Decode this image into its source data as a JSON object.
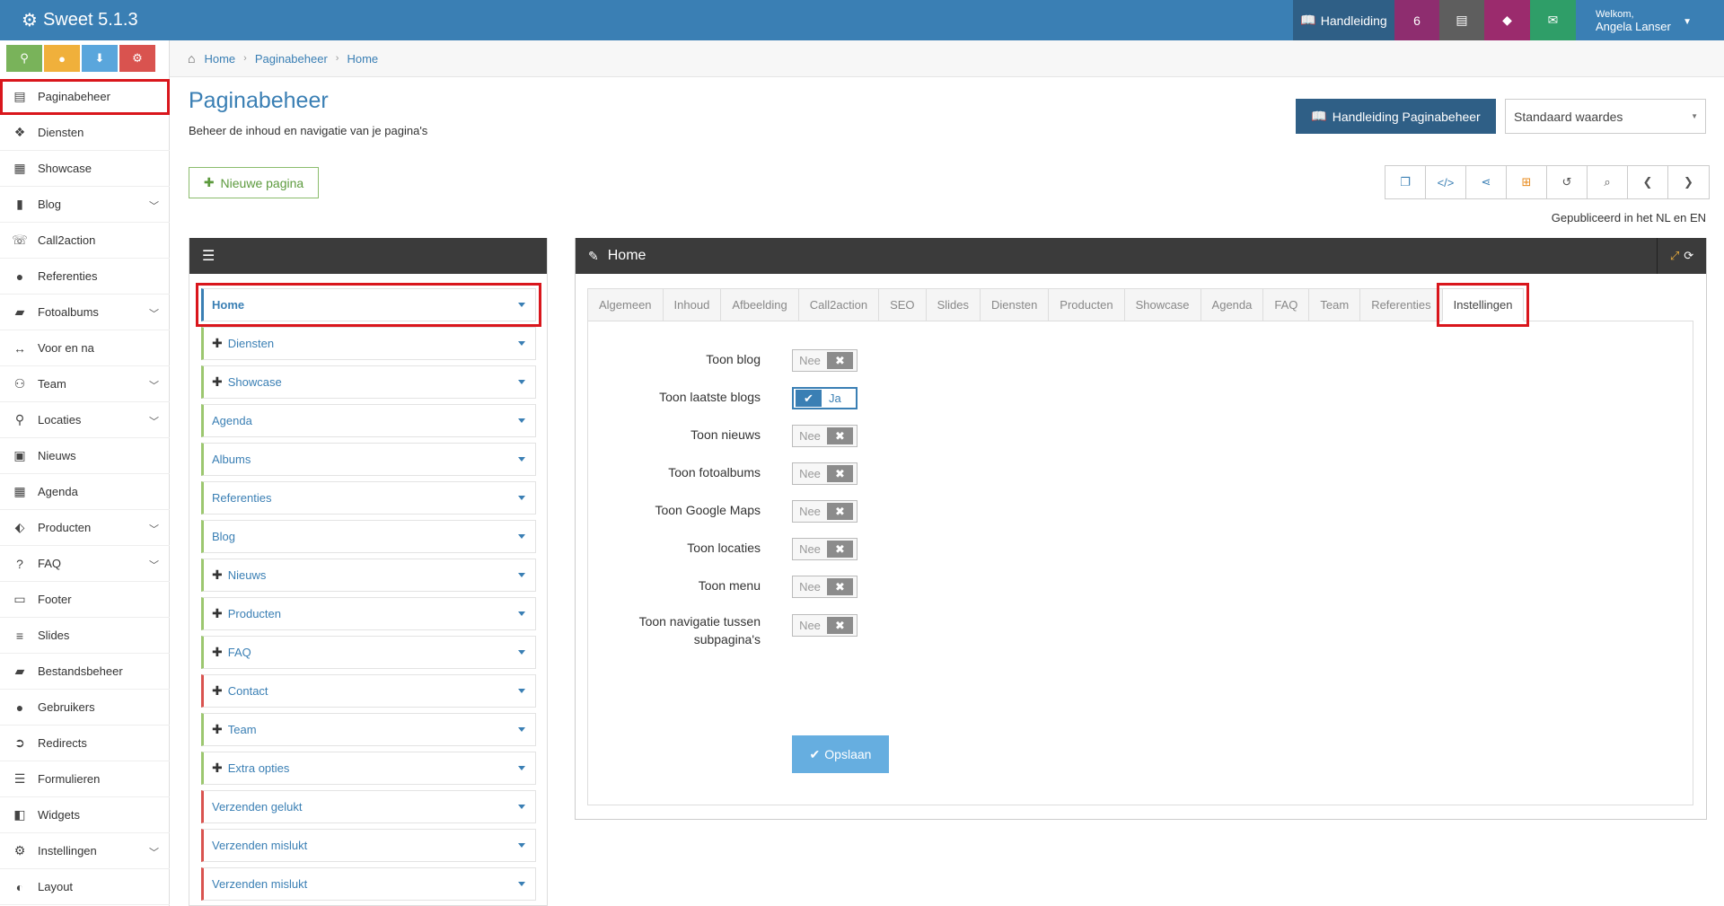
{
  "app": {
    "title": "Sweet 5.1.3"
  },
  "topbar": {
    "manual_label": "Handleiding",
    "count": "6",
    "welcome": "Welkom,",
    "user": "Angela Lanser"
  },
  "sidebar": {
    "items": [
      {
        "label": "Paginabeheer",
        "icon": "table-icon",
        "chevron": false
      },
      {
        "label": "Diensten",
        "icon": "cubes-icon",
        "chevron": false
      },
      {
        "label": "Showcase",
        "icon": "grid-icon",
        "chevron": false
      },
      {
        "label": "Blog",
        "icon": "file-icon",
        "chevron": true
      },
      {
        "label": "Call2action",
        "icon": "phone-icon",
        "chevron": false
      },
      {
        "label": "Referenties",
        "icon": "comments-icon",
        "chevron": false
      },
      {
        "label": "Fotoalbums",
        "icon": "book-icon",
        "chevron": true
      },
      {
        "label": "Voor en na",
        "icon": "arrows-h-icon",
        "chevron": false
      },
      {
        "label": "Team",
        "icon": "users-icon",
        "chevron": true
      },
      {
        "label": "Locaties",
        "icon": "map-marker-icon",
        "chevron": true
      },
      {
        "label": "Nieuws",
        "icon": "newspaper-icon",
        "chevron": false
      },
      {
        "label": "Agenda",
        "icon": "calendar-icon",
        "chevron": false
      },
      {
        "label": "Producten",
        "icon": "tags-icon",
        "chevron": true
      },
      {
        "label": "FAQ",
        "icon": "question-icon",
        "chevron": true
      },
      {
        "label": "Footer",
        "icon": "footer-icon",
        "chevron": false
      },
      {
        "label": "Slides",
        "icon": "sliders-icon",
        "chevron": false
      },
      {
        "label": "Bestandsbeheer",
        "icon": "folder-icon",
        "chevron": false
      },
      {
        "label": "Gebruikers",
        "icon": "user-icon",
        "chevron": false
      },
      {
        "label": "Redirects",
        "icon": "redirect-icon",
        "chevron": false
      },
      {
        "label": "Formulieren",
        "icon": "form-icon",
        "chevron": false
      },
      {
        "label": "Widgets",
        "icon": "widget-icon",
        "chevron": false
      },
      {
        "label": "Instellingen",
        "icon": "gear-icon",
        "chevron": true
      },
      {
        "label": "Layout",
        "icon": "palette-icon",
        "chevron": false
      }
    ]
  },
  "breadcrumb": [
    "Home",
    "Paginabeheer",
    "Home"
  ],
  "page": {
    "title": "Paginabeheer",
    "subtitle": "Beheer de inhoud en navigatie van je pagina's",
    "manual_button": "Handleiding Paginabeheer",
    "select_value": "Standaard waardes",
    "new_page": "Nieuwe pagina",
    "published": "Gepubliceerd in het NL en EN"
  },
  "tree": {
    "items": [
      {
        "label": "Home",
        "plus": false,
        "color": "blue"
      },
      {
        "label": "Diensten",
        "plus": true,
        "color": "green"
      },
      {
        "label": "Showcase",
        "plus": true,
        "color": "green"
      },
      {
        "label": "Agenda",
        "plus": false,
        "color": "green"
      },
      {
        "label": "Albums",
        "plus": false,
        "color": "green"
      },
      {
        "label": "Referenties",
        "plus": false,
        "color": "green"
      },
      {
        "label": "Blog",
        "plus": false,
        "color": "green"
      },
      {
        "label": "Nieuws",
        "plus": true,
        "color": "green"
      },
      {
        "label": "Producten",
        "plus": true,
        "color": "green"
      },
      {
        "label": "FAQ",
        "plus": true,
        "color": "green"
      },
      {
        "label": "Contact",
        "plus": true,
        "color": "red"
      },
      {
        "label": "Team",
        "plus": true,
        "color": "green"
      },
      {
        "label": "Extra opties",
        "plus": true,
        "color": "green"
      },
      {
        "label": "Verzenden gelukt",
        "plus": false,
        "color": "red"
      },
      {
        "label": "Verzenden mislukt",
        "plus": false,
        "color": "red"
      },
      {
        "label": "Verzenden mislukt",
        "plus": false,
        "color": "red"
      }
    ]
  },
  "editor": {
    "title": "Home",
    "tabs": [
      "Algemeen",
      "Inhoud",
      "Afbeelding",
      "Call2action",
      "SEO",
      "Slides",
      "Diensten",
      "Producten",
      "Showcase",
      "Agenda",
      "FAQ",
      "Team",
      "Referenties",
      "Instellingen"
    ],
    "active_tab": "Instellingen",
    "fields": [
      {
        "label": "Toon blog",
        "value": "Nee",
        "on": false
      },
      {
        "label": "Toon laatste blogs",
        "value": "Ja",
        "on": true
      },
      {
        "label": "Toon nieuws",
        "value": "Nee",
        "on": false
      },
      {
        "label": "Toon fotoalbums",
        "value": "Nee",
        "on": false
      },
      {
        "label": "Toon Google Maps",
        "value": "Nee",
        "on": false
      },
      {
        "label": "Toon locaties",
        "value": "Nee",
        "on": false
      },
      {
        "label": "Toon menu",
        "value": "Nee",
        "on": false
      },
      {
        "label": "Toon navigatie tussen subpagina's",
        "value": "Nee",
        "on": false
      }
    ],
    "save_label": "Opslaan"
  }
}
